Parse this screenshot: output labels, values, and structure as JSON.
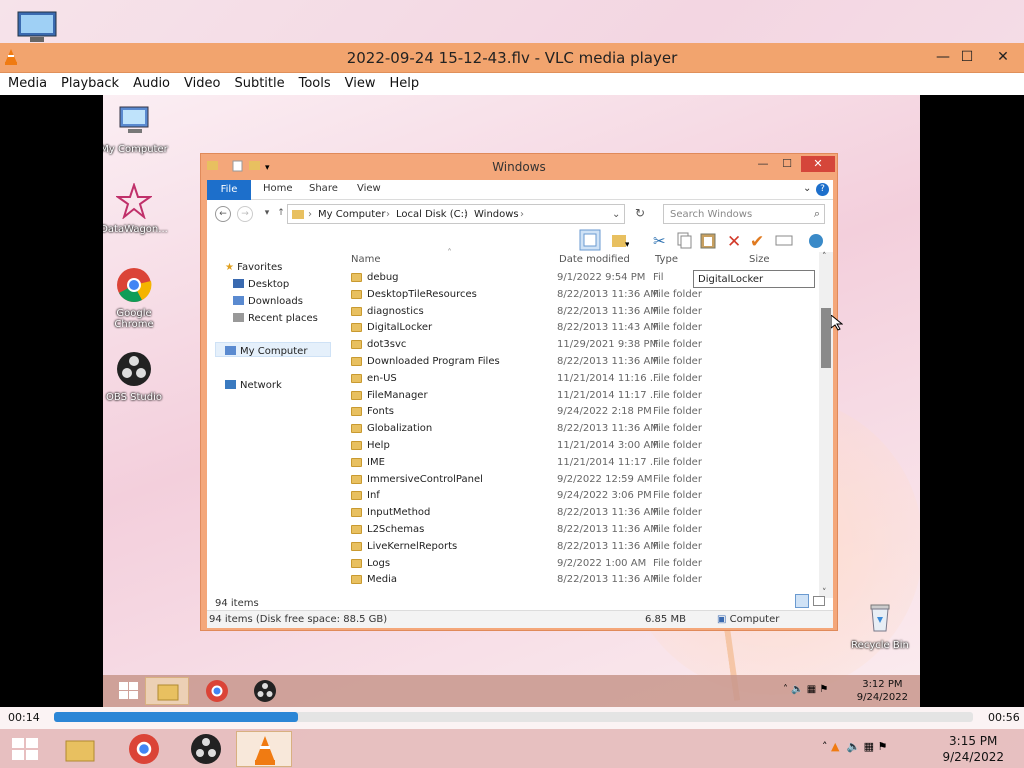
{
  "vlc": {
    "title": "2022-09-24 15-12-43.flv - VLC media player",
    "menu": [
      "Media",
      "Playback",
      "Audio",
      "Video",
      "Subtitle",
      "Tools",
      "View",
      "Help"
    ],
    "time_elapsed": "00:14",
    "time_total": "00:56",
    "progress": 0.265
  },
  "desktop_icons": [
    {
      "label": "My Computer"
    },
    {
      "label": "DataWagon..."
    },
    {
      "label": "Google Chrome"
    },
    {
      "label": "OBS Studio"
    },
    {
      "label": "Recycle Bin"
    }
  ],
  "explorer": {
    "title": "Windows",
    "ribbon_tabs": [
      "File",
      "Home",
      "Share",
      "View"
    ],
    "breadcrumb": [
      "My Computer",
      "Local Disk (C:)",
      "Windows"
    ],
    "search_placeholder": "Search Windows",
    "columns": [
      "Name",
      "Date modified",
      "Type",
      "Size"
    ],
    "nav": {
      "favorites": "Favorites",
      "desktop": "Desktop",
      "downloads": "Downloads",
      "recent": "Recent places",
      "computer": "My Computer",
      "network": "Network"
    },
    "rename_value": "DigitalLocker",
    "files": [
      {
        "name": "debug",
        "date": "9/1/2022 9:54 PM",
        "type": "Fil"
      },
      {
        "name": "DesktopTileResources",
        "date": "8/22/2013 11:36 AM",
        "type": "File folder"
      },
      {
        "name": "diagnostics",
        "date": "8/22/2013 11:36 AM",
        "type": "File folder"
      },
      {
        "name": "DigitalLocker",
        "date": "8/22/2013 11:43 AM",
        "type": "File folder"
      },
      {
        "name": "dot3svc",
        "date": "11/29/2021 9:38 PM",
        "type": "File folder"
      },
      {
        "name": "Downloaded Program Files",
        "date": "8/22/2013 11:36 AM",
        "type": "File folder"
      },
      {
        "name": "en-US",
        "date": "11/21/2014 11:16 ...",
        "type": "File folder"
      },
      {
        "name": "FileManager",
        "date": "11/21/2014 11:17 ...",
        "type": "File folder"
      },
      {
        "name": "Fonts",
        "date": "9/24/2022 2:18 PM",
        "type": "File folder"
      },
      {
        "name": "Globalization",
        "date": "8/22/2013 11:36 AM",
        "type": "File folder"
      },
      {
        "name": "Help",
        "date": "11/21/2014 3:00 AM",
        "type": "File folder"
      },
      {
        "name": "IME",
        "date": "11/21/2014 11:17 ...",
        "type": "File folder"
      },
      {
        "name": "ImmersiveControlPanel",
        "date": "9/2/2022 12:59 AM",
        "type": "File folder"
      },
      {
        "name": "Inf",
        "date": "9/24/2022 3:06 PM",
        "type": "File folder"
      },
      {
        "name": "InputMethod",
        "date": "8/22/2013 11:36 AM",
        "type": "File folder"
      },
      {
        "name": "L2Schemas",
        "date": "8/22/2013 11:36 AM",
        "type": "File folder"
      },
      {
        "name": "LiveKernelReports",
        "date": "8/22/2013 11:36 AM",
        "type": "File folder"
      },
      {
        "name": "Logs",
        "date": "9/2/2022 1:00 AM",
        "type": "File folder"
      },
      {
        "name": "Media",
        "date": "8/22/2013 11:36 AM",
        "type": "File folder"
      }
    ],
    "item_count": "94 items",
    "status_detail": "94 items (Disk free space: 88.5 GB)",
    "status_size": "6.85 MB",
    "status_location": "Computer"
  },
  "inner_clock": {
    "time": "3:12 PM",
    "date": "9/24/2022"
  },
  "outer_clock": {
    "time": "3:15 PM",
    "date": "9/24/2022"
  },
  "colors": {
    "vlc_title": "#f2a46e",
    "accent": "#1d6fcb",
    "seek": "#2c86d6"
  }
}
